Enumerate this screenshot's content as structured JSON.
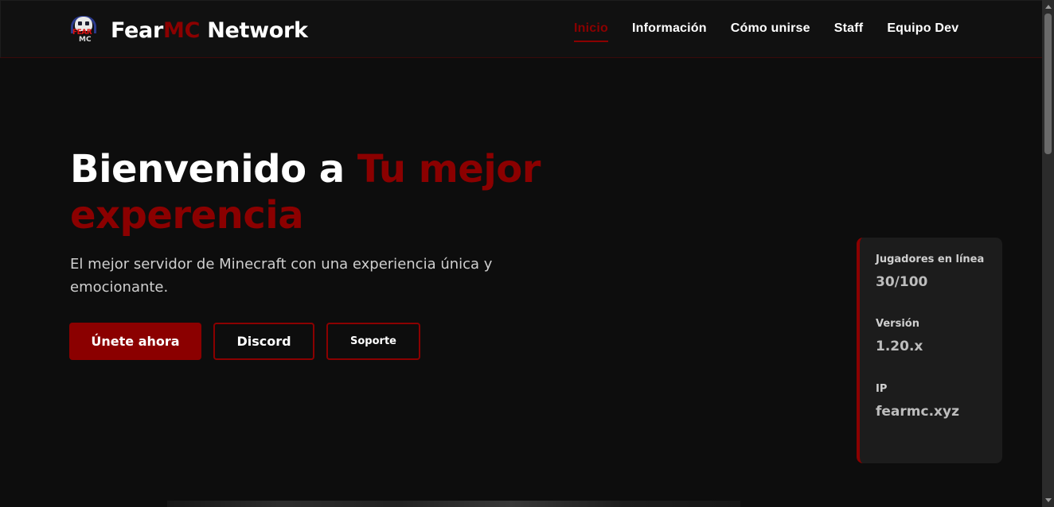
{
  "brand": {
    "logo_name": "fearmc-logo",
    "logo_text_line1": "FEAR",
    "logo_text_line2": "MC",
    "title_part1": "Fear",
    "title_accent": "MC",
    "title_part2": " Network"
  },
  "nav": {
    "items": [
      {
        "label": "Inicio",
        "active": true
      },
      {
        "label": "Información",
        "active": false
      },
      {
        "label": "Cómo unirse",
        "active": false
      },
      {
        "label": "Staff",
        "active": false
      },
      {
        "label": "Equipo Dev",
        "active": false
      }
    ]
  },
  "hero": {
    "title_part1": "Bienvenido a ",
    "title_accent": "Tu mejor experencia",
    "subtitle": "El mejor servidor de Minecraft con una experiencia única y emocionante.",
    "buttons": {
      "join": "Únete ahora",
      "discord": "Discord",
      "support": "Soporte"
    }
  },
  "server_info": {
    "players_label": "Jugadores en línea",
    "players_value": "30/100",
    "version_label": "Versión",
    "version_value": "1.20.x",
    "ip_label": "IP",
    "ip_value": "fearmc.xyz"
  },
  "colors": {
    "accent": "#8b0000",
    "background": "#0d0d0d",
    "card": "#1c1c1c"
  }
}
